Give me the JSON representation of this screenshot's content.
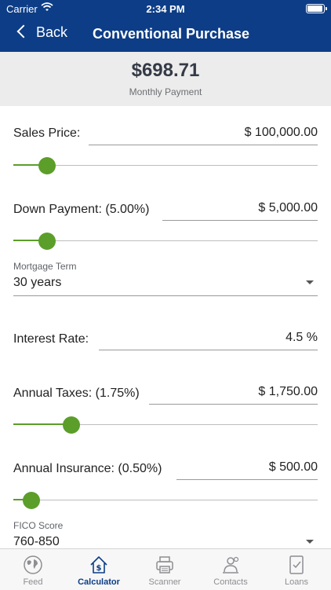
{
  "status_bar": {
    "carrier": "Carrier",
    "time": "2:34 PM"
  },
  "nav": {
    "back_label": "Back",
    "title": "Conventional Purchase"
  },
  "summary": {
    "amount": "$698.71",
    "caption": "Monthly Payment"
  },
  "sales_price": {
    "label": "Sales Price:",
    "value": "$ 100,000.00",
    "slider_level": 0.11
  },
  "down_payment": {
    "label": "Down Payment: (5.00%)",
    "value": "$ 5,000.00",
    "slider_level": 0.11
  },
  "mortgage_term": {
    "label": "Mortgage Term",
    "value": "30 years"
  },
  "interest_rate": {
    "label": "Interest Rate:",
    "value": "4.5 %"
  },
  "annual_taxes": {
    "label": "Annual Taxes: (1.75%)",
    "value": "$ 1,750.00",
    "slider_level": 0.19
  },
  "annual_insurance": {
    "label": "Annual Insurance: (0.50%)",
    "value": "$ 500.00",
    "slider_level": 0.06
  },
  "fico_score": {
    "label": "FICO Score",
    "value": "760-850"
  },
  "tabs": [
    {
      "label": "Feed",
      "icon": "globe-icon"
    },
    {
      "label": "Calculator",
      "icon": "house-dollar-icon"
    },
    {
      "label": "Scanner",
      "icon": "printer-icon"
    },
    {
      "label": "Contacts",
      "icon": "contacts-icon"
    },
    {
      "label": "Loans",
      "icon": "document-check-icon"
    }
  ],
  "colors": {
    "header": "#0d3d86",
    "accent": "#5b9e2a",
    "summary_bg": "#ececec",
    "active_tab": "#0d3d86"
  }
}
